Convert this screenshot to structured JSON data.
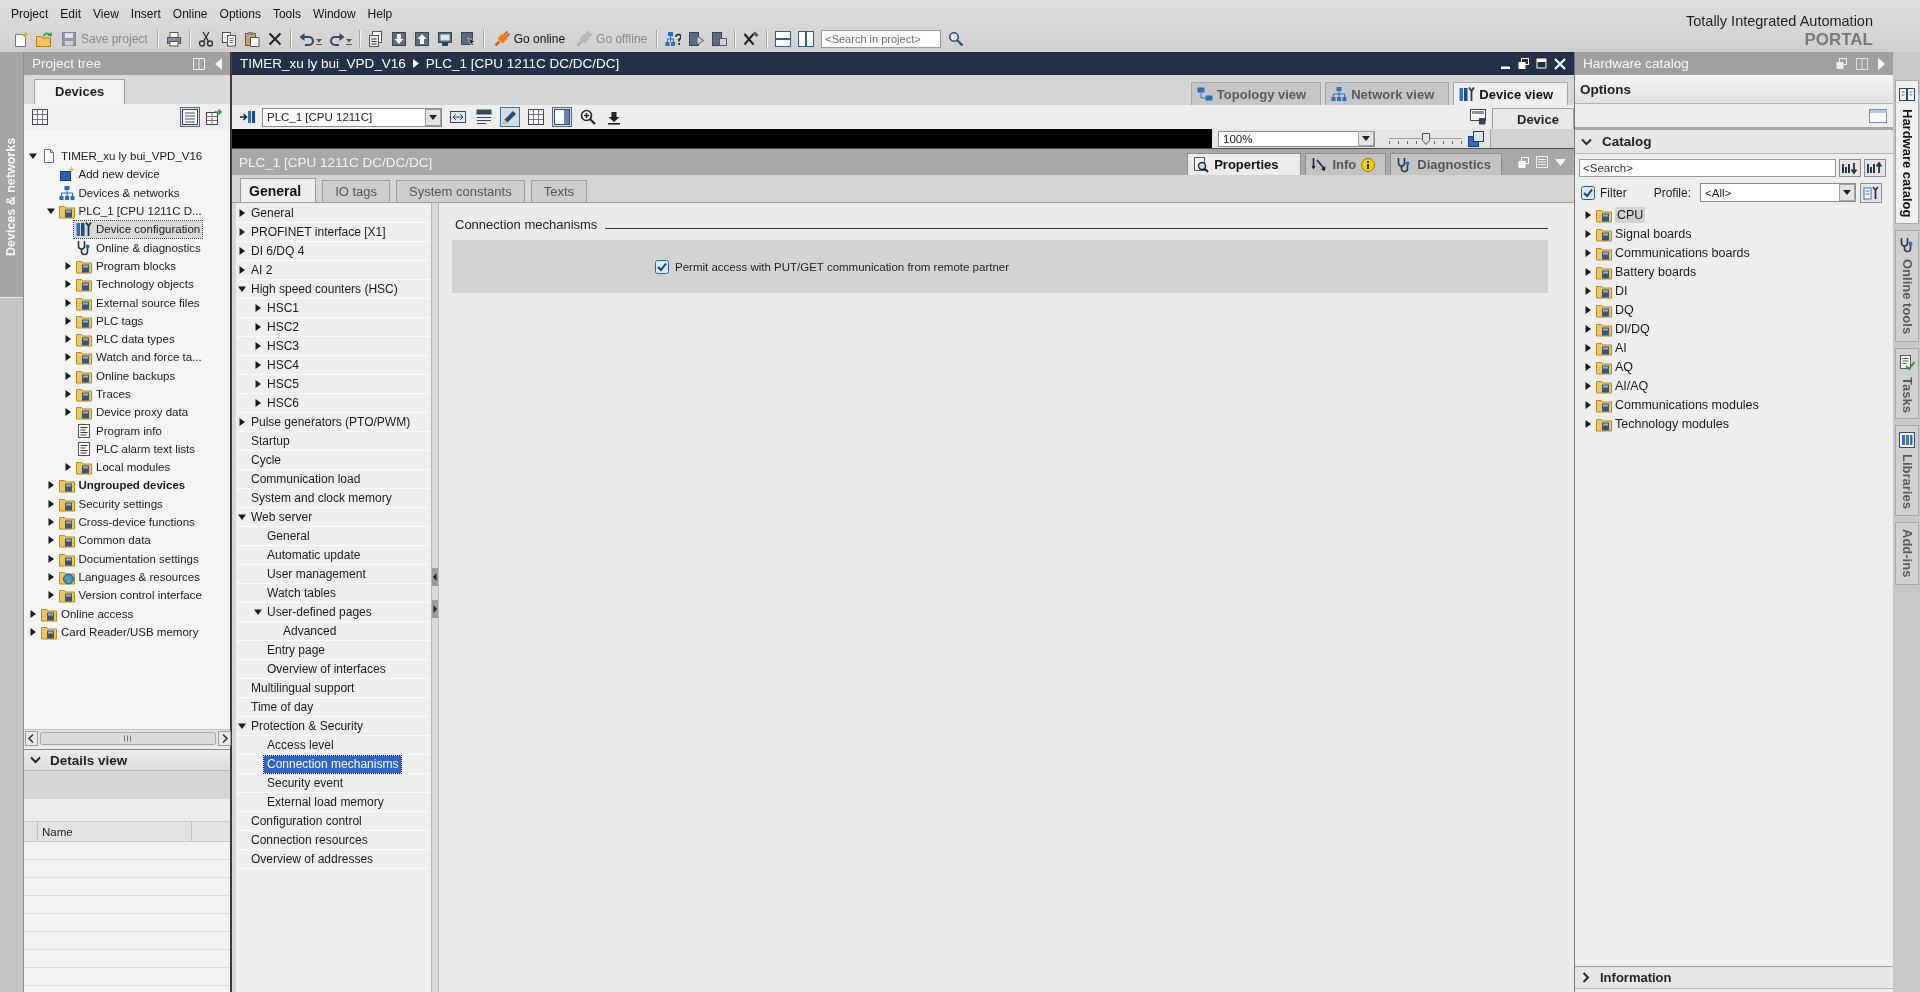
{
  "menu_bar": [
    "Project",
    "Edit",
    "View",
    "Insert",
    "Online",
    "Options",
    "Tools",
    "Window",
    "Help"
  ],
  "toolbar": {
    "buttons": [
      {
        "label": "Save project",
        "disabled": true
      },
      {
        "label": "Go online",
        "disabled": false
      },
      {
        "label": "Go offline",
        "disabled": true
      }
    ],
    "search": {
      "placeholder": "<Search in project>"
    }
  },
  "brand": {
    "title": "Totally Integrated Automation",
    "subtitle": "PORTAL"
  },
  "left_strip": {
    "label": "Devices & networks"
  },
  "project_tree": {
    "title": "Project tree",
    "tabs": [
      {
        "label": "Devices",
        "selected": true
      }
    ],
    "tools": [
      {
        "kind": "grid",
        "on": false
      },
      {
        "kind": "list",
        "on": true
      },
      {
        "kind": "table",
        "on": false
      }
    ],
    "items": [
      {
        "label": "TIMER_xu ly bui_VPD_V16",
        "kind": "project",
        "expanded": true,
        "selected": false,
        "children": [
          {
            "label": "Add new device",
            "kind": "add",
            "selected": false
          },
          {
            "label": "Devices & networks",
            "kind": "network",
            "selected": false
          },
          {
            "label": "PLC_1 [CPU 1211C D...",
            "kind": "folder",
            "expanded": true,
            "selected": false,
            "children": [
              {
                "label": "Device configuration",
                "kind": "config",
                "selected": true
              },
              {
                "label": "Online & diagnostics",
                "kind": "diagnostics",
                "selected": false
              },
              {
                "label": "Program blocks",
                "kind": "folder",
                "expanded": false,
                "selected": false
              },
              {
                "label": "Technology objects",
                "kind": "folder",
                "expanded": false,
                "selected": false
              },
              {
                "label": "External source files",
                "kind": "folder",
                "expanded": false,
                "selected": false
              },
              {
                "label": "PLC tags",
                "kind": "folder",
                "expanded": false,
                "selected": false
              },
              {
                "label": "PLC data types",
                "kind": "folder",
                "expanded": false,
                "selected": false
              },
              {
                "label": "Watch and force ta...",
                "kind": "folder",
                "expanded": false,
                "selected": false
              },
              {
                "label": "Online backups",
                "kind": "folder",
                "expanded": false,
                "selected": false
              },
              {
                "label": "Traces",
                "kind": "folder",
                "expanded": false,
                "selected": false
              },
              {
                "label": "Device proxy data",
                "kind": "folder",
                "expanded": false,
                "selected": false
              },
              {
                "label": "Program info",
                "kind": "list",
                "selected": false
              },
              {
                "label": "PLC alarm text lists",
                "kind": "list",
                "selected": false
              },
              {
                "label": "Local modules",
                "kind": "folder",
                "expanded": false,
                "selected": false
              }
            ]
          },
          {
            "label": "Ungrouped devices",
            "kind": "folder",
            "expanded": false,
            "selected": false,
            "bold": true
          },
          {
            "label": "Security settings",
            "kind": "folder",
            "expanded": false,
            "selected": false
          },
          {
            "label": "Cross-device functions",
            "kind": "folder",
            "expanded": false,
            "selected": false
          },
          {
            "label": "Common data",
            "kind": "folder",
            "expanded": false,
            "selected": false
          },
          {
            "label": "Documentation settings",
            "kind": "folder",
            "expanded": false,
            "selected": false
          },
          {
            "label": "Languages & resources",
            "kind": "globe",
            "expanded": false,
            "selected": false
          },
          {
            "label": "Version control interface",
            "kind": "folder",
            "expanded": false,
            "selected": false
          }
        ]
      },
      {
        "label": "Online access",
        "kind": "folder",
        "expanded": false,
        "selected": false
      },
      {
        "label": "Card Reader/USB memory",
        "kind": "folder",
        "expanded": false,
        "selected": false
      }
    ]
  },
  "details_view": {
    "title": "Details view",
    "expanded": true,
    "columns": [
      "Name"
    ]
  },
  "editor": {
    "breadcrumb": [
      "TIMER_xu ly bui_VPD_V16",
      "PLC_1 [CPU 1211C DC/DC/DC]"
    ],
    "view_tabs": [
      {
        "label": "Topology view",
        "kind": "topology",
        "selected": false
      },
      {
        "label": "Network view",
        "kind": "network",
        "selected": false
      },
      {
        "label": "Device view",
        "kind": "device",
        "selected": true
      }
    ],
    "device_select": {
      "value": "PLC_1 [CPU 1211C]"
    },
    "tools": [
      {
        "kind": "arrange",
        "on": false
      },
      {
        "kind": "rename",
        "on": false
      },
      {
        "kind": "pen",
        "on": true
      },
      {
        "kind": "grid",
        "on": false
      },
      {
        "kind": "panel",
        "on": true
      },
      {
        "kind": "zoom",
        "on": false
      },
      {
        "kind": "arrowdown",
        "on": false
      }
    ],
    "zoom": {
      "value": "100%"
    },
    "zoom_slider": {
      "level": 0.5
    },
    "overview_tab": {
      "label": "Device"
    }
  },
  "inspector": {
    "title": "PLC_1 [CPU 1211C DC/DC/DC]",
    "tabs": [
      {
        "label": "Properties",
        "kind": "properties",
        "selected": true
      },
      {
        "label": "Info",
        "kind": "info",
        "selected": false
      },
      {
        "label": "Diagnostics",
        "kind": "diagnostics",
        "selected": false
      }
    ],
    "sub_tabs": [
      {
        "label": "General",
        "selected": true
      },
      {
        "label": "IO tags",
        "selected": false
      },
      {
        "label": "System constants",
        "selected": false
      },
      {
        "label": "Texts",
        "selected": false
      }
    ],
    "nav": [
      {
        "label": "General",
        "expanded": false,
        "selected": false
      },
      {
        "label": "PROFINET interface [X1]",
        "expanded": false,
        "selected": false
      },
      {
        "label": "DI 6/DQ 4",
        "expanded": false,
        "selected": false
      },
      {
        "label": "AI 2",
        "expanded": false,
        "selected": false
      },
      {
        "label": "High speed counters (HSC)",
        "expanded": true,
        "selected": false,
        "children": [
          {
            "label": "HSC1",
            "expanded": false,
            "selected": false
          },
          {
            "label": "HSC2",
            "expanded": false,
            "selected": false
          },
          {
            "label": "HSC3",
            "expanded": false,
            "selected": false
          },
          {
            "label": "HSC4",
            "expanded": false,
            "selected": false
          },
          {
            "label": "HSC5",
            "expanded": false,
            "selected": false
          },
          {
            "label": "HSC6",
            "expanded": false,
            "selected": false
          }
        ]
      },
      {
        "label": "Pulse generators (PTO/PWM)",
        "expanded": false,
        "selected": false
      },
      {
        "label": "Startup",
        "selected": false
      },
      {
        "label": "Cycle",
        "selected": false
      },
      {
        "label": "Communication load",
        "selected": false
      },
      {
        "label": "System and clock memory",
        "selected": false
      },
      {
        "label": "Web server",
        "expanded": true,
        "selected": false,
        "children": [
          {
            "label": "General",
            "selected": false
          },
          {
            "label": "Automatic update",
            "selected": false
          },
          {
            "label": "User management",
            "selected": false
          },
          {
            "label": "Watch tables",
            "selected": false
          },
          {
            "label": "User-defined pages",
            "expanded": true,
            "selected": false,
            "children": [
              {
                "label": "Advanced",
                "selected": false
              }
            ]
          },
          {
            "label": "Entry page",
            "selected": false
          },
          {
            "label": "Overview of interfaces",
            "selected": false
          }
        ]
      },
      {
        "label": "Multilingual support",
        "selected": false
      },
      {
        "label": "Time of day",
        "selected": false
      },
      {
        "label": "Protection & Security",
        "expanded": true,
        "selected": false,
        "children": [
          {
            "label": "Access level",
            "selected": false
          },
          {
            "label": "Connection mechanisms",
            "selected": true
          },
          {
            "label": "Security event",
            "selected": false
          },
          {
            "label": "External load memory",
            "selected": false
          }
        ]
      },
      {
        "label": "Configuration control",
        "selected": false
      },
      {
        "label": "Connection resources",
        "selected": false
      },
      {
        "label": "Overview of addresses",
        "selected": false
      }
    ],
    "section": {
      "title": "Connection mechanisms",
      "options": [
        {
          "label": "Permit access with PUT/GET communication from remote partner",
          "checked": true
        }
      ]
    }
  },
  "catalog": {
    "title": "Hardware catalog",
    "options_label": "Options",
    "section": {
      "title": "Catalog",
      "expanded": true
    },
    "search": {
      "placeholder": "<Search>"
    },
    "filter": {
      "label": "Filter",
      "checked": true
    },
    "profile": {
      "label": "Profile:",
      "value": "<All>"
    },
    "items": [
      {
        "label": "CPU",
        "kind": "folder",
        "expanded": false,
        "selected": true
      },
      {
        "label": "Signal boards",
        "kind": "folder",
        "expanded": false,
        "selected": false
      },
      {
        "label": "Communications boards",
        "kind": "folder",
        "expanded": false,
        "selected": false
      },
      {
        "label": "Battery boards",
        "kind": "folder",
        "expanded": false,
        "selected": false
      },
      {
        "label": "DI",
        "kind": "folder",
        "expanded": false,
        "selected": false
      },
      {
        "label": "DQ",
        "kind": "folder",
        "expanded": false,
        "selected": false
      },
      {
        "label": "DI/DQ",
        "kind": "folder",
        "expanded": false,
        "selected": false
      },
      {
        "label": "AI",
        "kind": "folder",
        "expanded": false,
        "selected": false
      },
      {
        "label": "AQ",
        "kind": "folder",
        "expanded": false,
        "selected": false
      },
      {
        "label": "AI/AQ",
        "kind": "folder",
        "expanded": false,
        "selected": false
      },
      {
        "label": "Communications modules",
        "kind": "folder",
        "expanded": false,
        "selected": false
      },
      {
        "label": "Technology modules",
        "kind": "folder",
        "expanded": false,
        "selected": false
      }
    ],
    "information": {
      "title": "Information",
      "expanded": false
    }
  },
  "right_tabs": [
    {
      "label": "Hardware catalog",
      "kind": "catalog",
      "selected": true
    },
    {
      "label": "Online tools",
      "kind": "online",
      "selected": false
    },
    {
      "label": "Tasks",
      "kind": "tasks",
      "selected": false
    },
    {
      "label": "Libraries",
      "kind": "libraries",
      "selected": false
    },
    {
      "label": "Add-ins",
      "kind": "addins",
      "selected": false
    }
  ]
}
